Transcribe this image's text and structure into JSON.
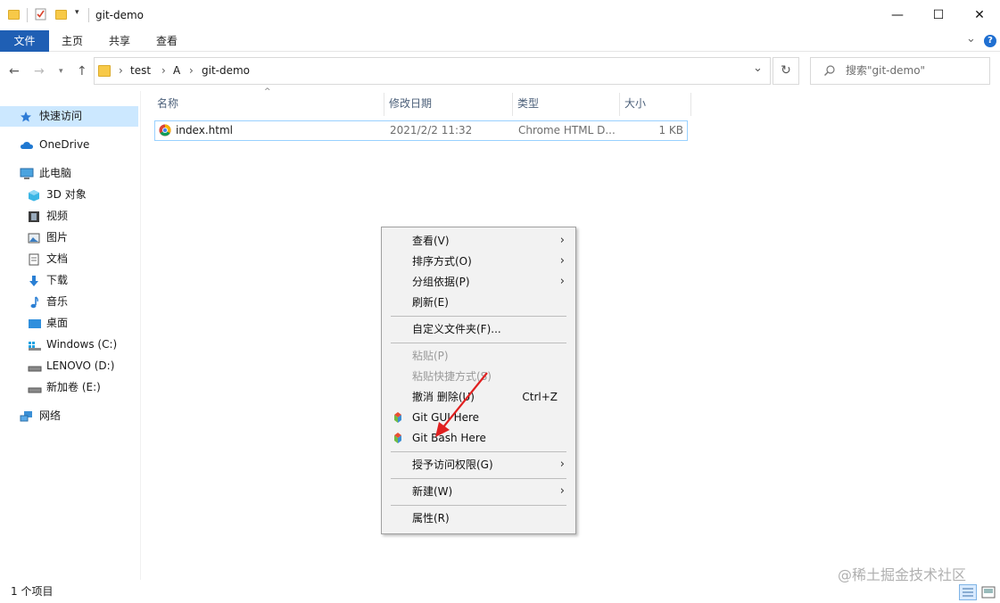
{
  "window": {
    "title": "git-demo",
    "minimize_glyph": "—",
    "maximize_glyph": "☐",
    "close_glyph": "✕"
  },
  "ribbon": {
    "tabs": [
      "文件",
      "主页",
      "共享",
      "查看"
    ],
    "collapse_glyph": "⌄",
    "help_glyph": "?"
  },
  "address": {
    "breadcrumbs": [
      "test",
      "A",
      "git-demo"
    ],
    "separator": "›",
    "dropdown_glyph": "⌄",
    "refresh_glyph": "↻",
    "search_placeholder": "搜索\"git-demo\""
  },
  "sidebar": {
    "items": [
      {
        "label": "快速访问",
        "icon": "star-icon"
      },
      {
        "label": "OneDrive",
        "icon": "cloud-icon"
      },
      {
        "label": "此电脑",
        "icon": "computer-icon"
      },
      {
        "label": "3D 对象",
        "icon": "cube-icon"
      },
      {
        "label": "视频",
        "icon": "video-icon"
      },
      {
        "label": "图片",
        "icon": "picture-icon"
      },
      {
        "label": "文档",
        "icon": "document-icon"
      },
      {
        "label": "下载",
        "icon": "download-icon"
      },
      {
        "label": "音乐",
        "icon": "music-icon"
      },
      {
        "label": "桌面",
        "icon": "desktop-icon"
      },
      {
        "label": "Windows (C:)",
        "icon": "drive-c-icon"
      },
      {
        "label": "LENOVO (D:)",
        "icon": "drive-icon"
      },
      {
        "label": "新加卷 (E:)",
        "icon": "drive-icon"
      },
      {
        "label": "网络",
        "icon": "network-icon"
      }
    ]
  },
  "columns": [
    "名称",
    "修改日期",
    "类型",
    "大小"
  ],
  "files": [
    {
      "name": "index.html",
      "modified": "2021/2/2 11:32",
      "type": "Chrome HTML D...",
      "size": "1 KB",
      "icon": "chrome-icon"
    }
  ],
  "context_menu": {
    "items": [
      {
        "label": "查看(V)",
        "submenu": true,
        "disabled": false
      },
      {
        "label": "排序方式(O)",
        "submenu": true,
        "disabled": false
      },
      {
        "label": "分组依据(P)",
        "submenu": true,
        "disabled": false
      },
      {
        "label": "刷新(E)",
        "submenu": false,
        "disabled": false
      },
      {
        "label": "自定义文件夹(F)...",
        "submenu": false,
        "disabled": false
      },
      {
        "label": "粘贴(P)",
        "submenu": false,
        "disabled": true
      },
      {
        "label": "粘贴快捷方式(S)",
        "submenu": false,
        "disabled": true
      },
      {
        "label": "撤消 删除(U)",
        "shortcut": "Ctrl+Z",
        "submenu": false,
        "disabled": false
      },
      {
        "label": "Git GUI Here",
        "icon": "git-icon",
        "submenu": false,
        "disabled": false
      },
      {
        "label": "Git Bash Here",
        "icon": "git-icon",
        "submenu": false,
        "disabled": false
      },
      {
        "label": "授予访问权限(G)",
        "submenu": true,
        "disabled": false
      },
      {
        "label": "新建(W)",
        "submenu": true,
        "disabled": false
      },
      {
        "label": "属性(R)",
        "submenu": false,
        "disabled": false
      }
    ],
    "submenu_glyph": "›"
  },
  "status": {
    "item_count": "1 个项目"
  },
  "watermark": "@稀土掘金技术社区",
  "colors": {
    "accent": "#1f5fb4",
    "selection_border": "#99d1ff",
    "annotation_arrow": "#e02020"
  }
}
